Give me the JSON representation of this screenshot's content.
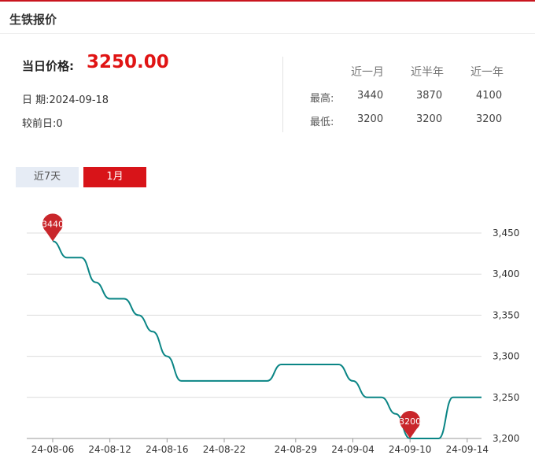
{
  "header": {
    "title": "生铁报价"
  },
  "price": {
    "label": "当日价格:",
    "value": "3250.00"
  },
  "meta": {
    "date": "日 期:2024-09-18",
    "change": "较前日:0"
  },
  "stats": {
    "columns": [
      "近一月",
      "近半年",
      "近一年"
    ],
    "rows": [
      {
        "label": "最高:",
        "values": [
          "3440",
          "3870",
          "4100"
        ]
      },
      {
        "label": "最低:",
        "values": [
          "3200",
          "3200",
          "3200"
        ]
      }
    ]
  },
  "tabs": [
    {
      "label": "近7天",
      "active": false
    },
    {
      "label": "1月",
      "active": true
    }
  ],
  "chart_data": {
    "type": "line",
    "x": [
      "24-08-06",
      "24-08-07",
      "24-08-08",
      "24-08-09",
      "24-08-12",
      "24-08-13",
      "24-08-14",
      "24-08-15",
      "24-08-16",
      "24-08-19",
      "24-08-20",
      "24-08-21",
      "24-08-22",
      "24-08-23",
      "24-08-26",
      "24-08-27",
      "24-08-28",
      "24-08-29",
      "24-08-30",
      "24-09-02",
      "24-09-03",
      "24-09-04",
      "24-09-05",
      "24-09-06",
      "24-09-09",
      "24-09-10",
      "24-09-11",
      "24-09-12",
      "24-09-13",
      "24-09-14",
      "24-09-18"
    ],
    "x_tick_labels": [
      "24-08-06",
      "24-08-12",
      "24-08-16",
      "24-08-22",
      "24-08-29",
      "24-09-04",
      "24-09-10",
      "24-09-14"
    ],
    "series": [
      {
        "values": [
          3440,
          3420,
          3420,
          3390,
          3370,
          3370,
          3350,
          3330,
          3300,
          3270,
          3270,
          3270,
          3270,
          3270,
          3270,
          3270,
          3290,
          3290,
          3290,
          3290,
          3290,
          3270,
          3250,
          3250,
          3230,
          3200,
          3200,
          3200,
          3250,
          3250,
          3250
        ]
      }
    ],
    "ylim": [
      3200,
      3450
    ],
    "y_ticks": [
      3200,
      3250,
      3300,
      3350,
      3400,
      3450
    ],
    "y_tick_labels": [
      "3,200",
      "3,250",
      "3,300",
      "3,350",
      "3,400",
      "3,450"
    ],
    "y_axis_side": "right",
    "grid": true,
    "line_color": "#0a8585",
    "pin_color": "#c9262b",
    "markers": [
      {
        "label": "3440",
        "index": 0,
        "value": 3440
      },
      {
        "label": "3200",
        "index": 25,
        "value": 3200
      }
    ]
  }
}
